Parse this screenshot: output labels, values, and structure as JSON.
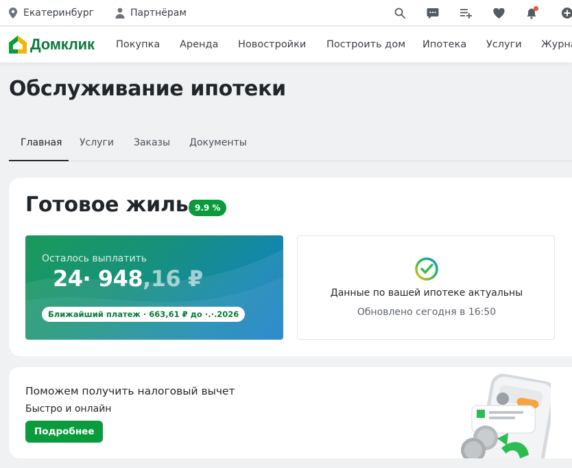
{
  "topbar": {
    "city": "Екатеринбург",
    "partners": "Партнёрам",
    "icons": [
      "search-icon",
      "chat-icon",
      "list-add-icon",
      "heart-icon",
      "bell-icon",
      "plus-circle-icon"
    ]
  },
  "nav": {
    "logo": "Домклик",
    "items": [
      "Покупка",
      "Аренда",
      "Новостройки",
      "Построить дом",
      "Ипотека",
      "Услуги",
      "Журнал"
    ]
  },
  "page": {
    "title": "Обслуживание ипотеки"
  },
  "tabs": [
    "Главная",
    "Услуги",
    "Заказы",
    "Документы"
  ],
  "mortgage": {
    "title": "Готовое жилье",
    "rate": "9.9 %",
    "balance_label": "Осталось выплатить",
    "balance_amount_main": "24· 948",
    "balance_amount_cents": ",16 ₽",
    "next_payment": "Ближайший платеж ·  663,61 ₽ до ·.·.2026",
    "status_title": "Данные по вашей ипотеке актуальны",
    "status_updated": "Обновлено сегодня в 16:50"
  },
  "tax": {
    "title": "Поможем получить налоговый вычет",
    "subtitle": "Быстро и онлайн",
    "button": "Подробнее"
  },
  "colors": {
    "brand_green": "#0a9b3c",
    "accent_orange": "#e8572e"
  }
}
